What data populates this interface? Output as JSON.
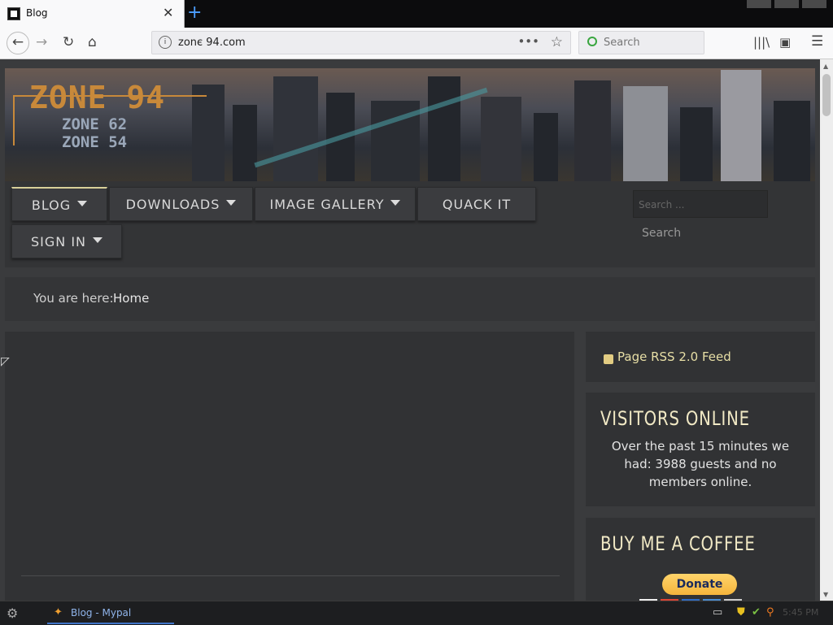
{
  "browser": {
    "tab_title": "Blog",
    "tab_close": "✕",
    "new_tab": "+",
    "url": "zonє 94.com",
    "search_placeholder": "Search"
  },
  "site": {
    "logo_main": "ZONE 94",
    "logo_sub1": "ZONE 62",
    "logo_sub2": "ZONE 54",
    "menu": [
      {
        "label": "BLOG",
        "dropdown": true,
        "active": true
      },
      {
        "label": "DOWNLOADS",
        "dropdown": true
      },
      {
        "label": "IMAGE GALLERY",
        "dropdown": true
      },
      {
        "label": "QUACK IT",
        "dropdown": false
      },
      {
        "label": "SIGN IN",
        "dropdown": true
      }
    ],
    "search_placeholder": "Search ...",
    "search_button": "Search",
    "breadcrumb_label": "You are here:",
    "breadcrumb_home": "Home",
    "rss_label": "Page RSS 2.0 Feed",
    "visitors_title": "VISITORS ONLINE",
    "visitors_text": "Over the past 15 minutes we had: 3988 guests and no members online.",
    "coffee_title": "BUY ME A COFFEE",
    "donate_label": "Donate"
  },
  "taskbar": {
    "window_label": "Blog - Mypal",
    "clock": "5:45 PM"
  },
  "colors": {
    "accent_gold": "#e8dfa6",
    "title_cream": "#f1e9c5",
    "donate_yellow": "#ffc439"
  }
}
